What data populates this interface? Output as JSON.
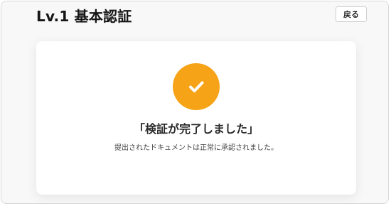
{
  "header": {
    "title": "Lv.1 基本認証",
    "back_label": "戻る"
  },
  "result": {
    "icon": "check-icon",
    "title": "「検証が完了しました」",
    "message": "提出されたドキュメントは正常に承認されました。"
  },
  "colors": {
    "accent": "#f6a317",
    "text": "#161616"
  }
}
